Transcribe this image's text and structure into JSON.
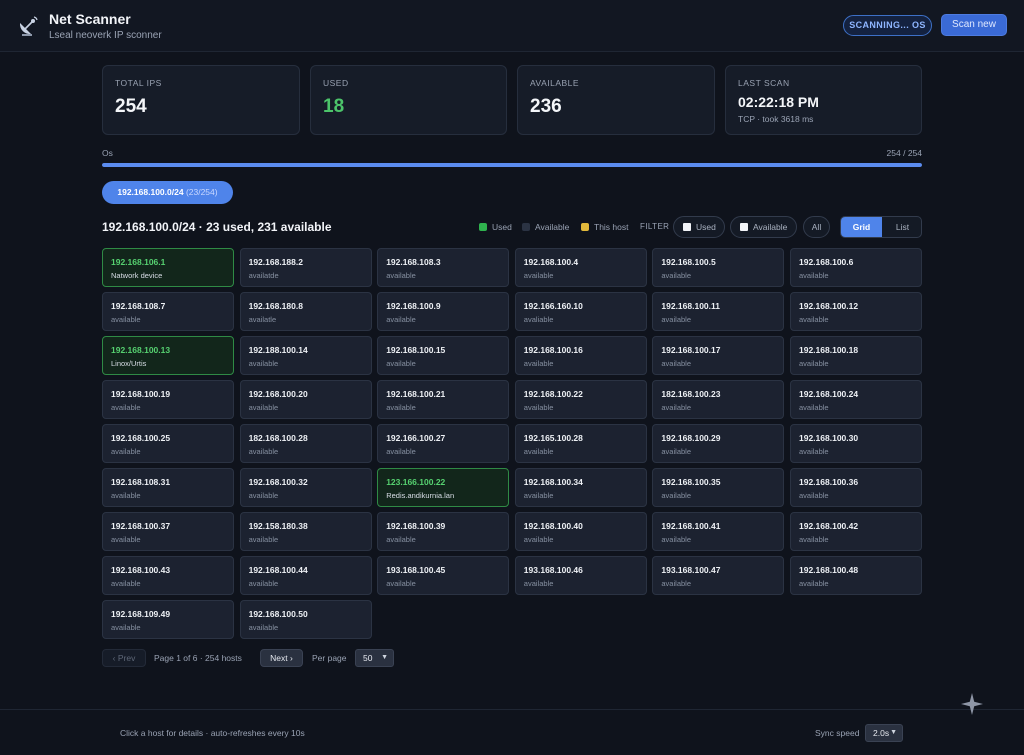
{
  "header": {
    "title": "Net Scanner",
    "subtitle": "Lseal neoverk IP sconner",
    "status_badge": "SCANNING... OS",
    "scan_new_label": "Scan new",
    "logo_icon": "satellite-dish-icon"
  },
  "stats": [
    {
      "label": "TOTAL IPS",
      "value": "254"
    },
    {
      "label": "USED",
      "value": "18"
    },
    {
      "label": "AVAILABLE",
      "value": "236"
    },
    {
      "label": "LAST SCAN",
      "value": "02:22:18 PM",
      "sub": "TCP · took 3618 ms"
    }
  ],
  "progress": {
    "left_label": "Os",
    "right_label": "254 / 254",
    "fraction": 1.0
  },
  "subnet_chip": {
    "label": "192.168.100.0/24",
    "count": "(23/254)"
  },
  "section": {
    "title": "192.168.100.0/24 · 23 used, 231 available"
  },
  "legend": [
    {
      "label": "Used",
      "color": "#2fb24e"
    },
    {
      "label": "Available",
      "color": "#2b3343"
    },
    {
      "label": "This host",
      "color": "#e2b93b"
    }
  ],
  "filter": {
    "label": "FILTER",
    "chips": [
      "Used",
      "Available",
      "All"
    ]
  },
  "view": {
    "grid_label": "Grid",
    "list_label": "List",
    "active": "grid"
  },
  "hosts": [
    {
      "ip": "192.168.106.1",
      "status": "Natwork device",
      "used": true
    },
    {
      "ip": "192.168.188.2",
      "status": "availatde",
      "used": false
    },
    {
      "ip": "192.168.108.3",
      "status": "available",
      "used": false
    },
    {
      "ip": "192.168.100.4",
      "status": "available",
      "used": false
    },
    {
      "ip": "192.168.100.5",
      "status": "available",
      "used": false
    },
    {
      "ip": "192.168.100.6",
      "status": "available",
      "used": false
    },
    {
      "ip": "192.168.108.7",
      "status": "available",
      "used": false
    },
    {
      "ip": "192.168.180.8",
      "status": "availatle",
      "used": false
    },
    {
      "ip": "192.168.100.9",
      "status": "available",
      "used": false
    },
    {
      "ip": "192.166.160.10",
      "status": "avaliable",
      "used": false
    },
    {
      "ip": "192.168.100.11",
      "status": "available",
      "used": false
    },
    {
      "ip": "192.168.100.12",
      "status": "available",
      "used": false
    },
    {
      "ip": "192.168.100.13",
      "status": "Linox/Urtis",
      "used": true
    },
    {
      "ip": "192.188.100.14",
      "status": "available",
      "used": false
    },
    {
      "ip": "192.168.100.15",
      "status": "available",
      "used": false
    },
    {
      "ip": "192.168.100.16",
      "status": "available",
      "used": false
    },
    {
      "ip": "192.168.100.17",
      "status": "available",
      "used": false
    },
    {
      "ip": "192.168.100.18",
      "status": "available",
      "used": false
    },
    {
      "ip": "192.168.100.19",
      "status": "available",
      "used": false
    },
    {
      "ip": "192.168.100.20",
      "status": "available",
      "used": false
    },
    {
      "ip": "192.168.100.21",
      "status": "available",
      "used": false
    },
    {
      "ip": "192.168.100.22",
      "status": "available",
      "used": false
    },
    {
      "ip": "182.168.100.23",
      "status": "available",
      "used": false
    },
    {
      "ip": "192.168.100.24",
      "status": "available",
      "used": false
    },
    {
      "ip": "192.168.100.25",
      "status": "available",
      "used": false
    },
    {
      "ip": "182.168.100.28",
      "status": "available",
      "used": false
    },
    {
      "ip": "192.166.100.27",
      "status": "available",
      "used": false
    },
    {
      "ip": "192.165.100.28",
      "status": "available",
      "used": false
    },
    {
      "ip": "192.168.100.29",
      "status": "available",
      "used": false
    },
    {
      "ip": "192.168.100.30",
      "status": "available",
      "used": false
    },
    {
      "ip": "192.168.108.31",
      "status": "available",
      "used": false
    },
    {
      "ip": "192.168.100.32",
      "status": "available",
      "used": false
    },
    {
      "ip": "123.166.100.22",
      "status": "Redis.andikurnia.lan",
      "used": true
    },
    {
      "ip": "192.168.100.34",
      "status": "available",
      "used": false
    },
    {
      "ip": "192.168.100.35",
      "status": "available",
      "used": false
    },
    {
      "ip": "192.168.100.36",
      "status": "available",
      "used": false
    },
    {
      "ip": "192.168.100.37",
      "status": "available",
      "used": false
    },
    {
      "ip": "192.158.180.38",
      "status": "available",
      "used": false
    },
    {
      "ip": "192.168.100.39",
      "status": "available",
      "used": false
    },
    {
      "ip": "192.168.100.40",
      "status": "available",
      "used": false
    },
    {
      "ip": "192.168.100.41",
      "status": "available",
      "used": false
    },
    {
      "ip": "192.168.100.42",
      "status": "available",
      "used": false
    },
    {
      "ip": "192.168.100.43",
      "status": "available",
      "used": false
    },
    {
      "ip": "192.168.100.44",
      "status": "available",
      "used": false
    },
    {
      "ip": "193.168.100.45",
      "status": "available",
      "used": false
    },
    {
      "ip": "193.168.100.46",
      "status": "available",
      "used": false
    },
    {
      "ip": "193.168.100.47",
      "status": "available",
      "used": false
    },
    {
      "ip": "192.168.100.48",
      "status": "available",
      "used": false
    },
    {
      "ip": "192.168.109.49",
      "status": "available",
      "used": false
    },
    {
      "ip": "192.168.100.50",
      "status": "available",
      "used": false
    }
  ],
  "pagination": {
    "prev_label": "‹ Prev",
    "page_info": "Page 1 of 6 · 254 hosts",
    "next_label": "Next ›",
    "per_page_label": "Per page",
    "per_page_value": "50"
  },
  "footer": {
    "hint": "Click a host for details · auto-refreshes every 10s",
    "sync_label": "Sync speed",
    "sync_value": "2.0s"
  }
}
